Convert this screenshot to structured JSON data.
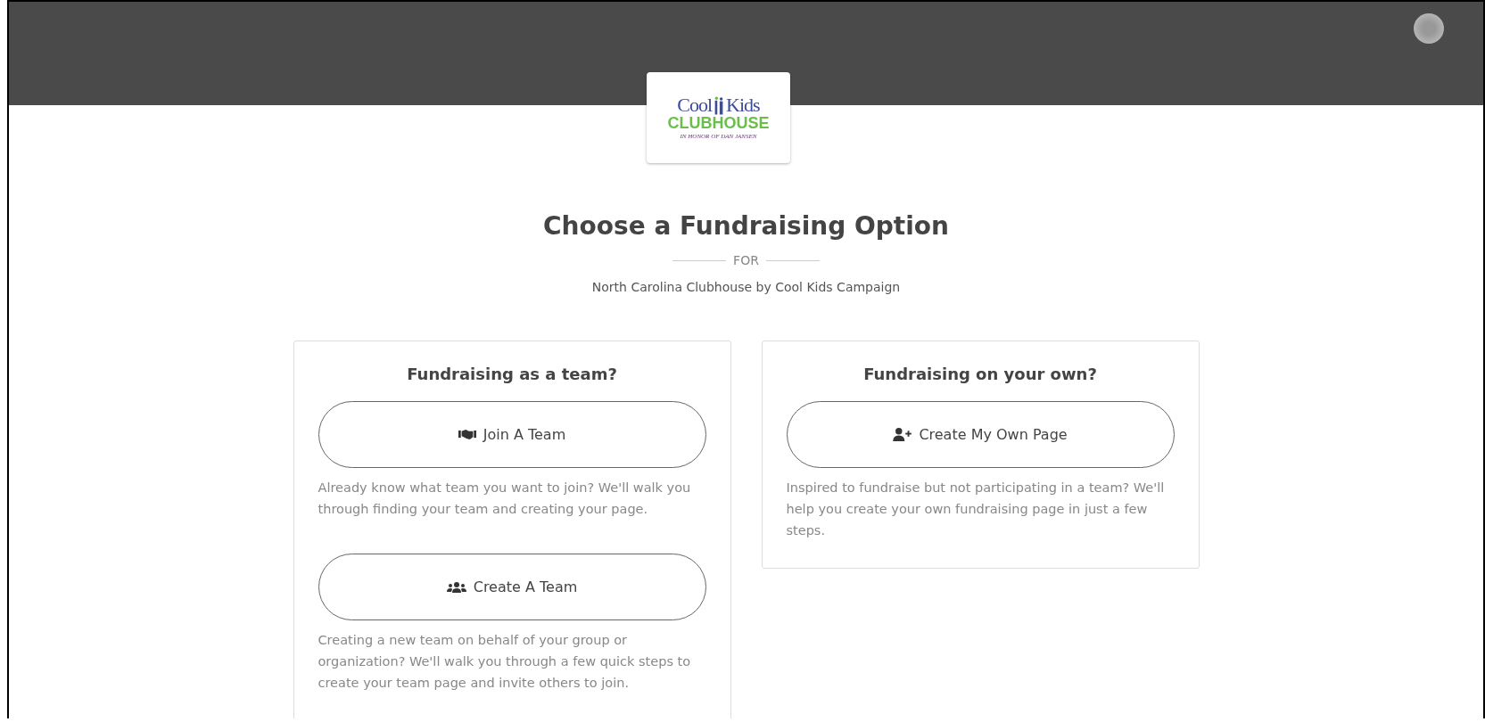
{
  "logo": {
    "word_1": "Cool",
    "word_2": "Kids",
    "line_2": "CLUBHOUSE",
    "tagline": "IN HONOR OF DAN JANSEN"
  },
  "title": "Choose a Fundraising Option",
  "separator": "FOR",
  "subtitle": "North Carolina Clubhouse by Cool Kids Campaign",
  "cards": [
    {
      "heading": "Fundraising as a team?",
      "options": [
        {
          "kind": "handshake",
          "label": "Join A Team",
          "description": "Already know what team you want to join? We'll walk you through finding your team and creating your page."
        },
        {
          "kind": "users",
          "label": "Create A Team",
          "description": "Creating a new team on behalf of your group or organization? We'll walk you through a few quick steps to create your team page and invite others to join."
        }
      ]
    },
    {
      "heading": "Fundraising on your own?",
      "options": [
        {
          "kind": "user-plus",
          "label": "Create My Own Page",
          "description": "Inspired to fundraise but not participating in a team? We'll help you create your own fundraising page in just a few steps."
        }
      ]
    }
  ]
}
